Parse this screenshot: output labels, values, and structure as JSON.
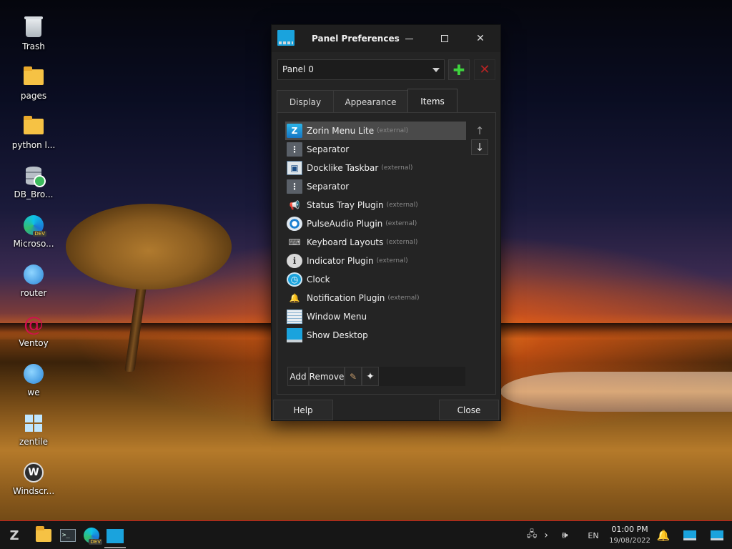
{
  "desktop": {
    "icons": [
      {
        "label": "Trash",
        "icon": "trash-icon"
      },
      {
        "label": "pages",
        "icon": "folder-icon"
      },
      {
        "label": "python l...",
        "icon": "folder-icon"
      },
      {
        "label": "DB_Bro...",
        "icon": "database-icon"
      },
      {
        "label": "Microso...",
        "icon": "edge-dev-icon"
      },
      {
        "label": "router",
        "icon": "globe-icon"
      },
      {
        "label": "Ventoy",
        "icon": "debian-icon"
      },
      {
        "label": "we",
        "icon": "globe-icon"
      },
      {
        "label": "zentile",
        "icon": "windows-logo-icon"
      },
      {
        "label": "Windscr...",
        "icon": "windscribe-icon"
      }
    ]
  },
  "dialog": {
    "title": "Panel Preferences",
    "panel_select": {
      "value": "Panel 0"
    },
    "add_panel_glyph": "✚",
    "remove_panel_glyph": "✕",
    "tabs": [
      {
        "label": "Display"
      },
      {
        "label": "Appearance"
      },
      {
        "label": "Items",
        "active": true
      }
    ],
    "items": [
      {
        "name": "Zorin Menu Lite",
        "ext": "(external)",
        "icon": "zorin-menu-icon",
        "glyph": "Z",
        "selected": true
      },
      {
        "name": "Separator",
        "ext": "",
        "icon": "separator-icon",
        "glyph": "⋮"
      },
      {
        "name": "Docklike Taskbar",
        "ext": "(external)",
        "icon": "taskbar-icon",
        "glyph": "▣"
      },
      {
        "name": "Separator",
        "ext": "",
        "icon": "separator-icon",
        "glyph": "⋮"
      },
      {
        "name": "Status Tray Plugin",
        "ext": "(external)",
        "icon": "megaphone-icon",
        "glyph": "📢"
      },
      {
        "name": "PulseAudio Plugin",
        "ext": "(external)",
        "icon": "speaker-icon",
        "glyph": ""
      },
      {
        "name": "Keyboard Layouts",
        "ext": "(external)",
        "icon": "keyboard-icon",
        "glyph": "⌨"
      },
      {
        "name": "Indicator Plugin",
        "ext": "(external)",
        "icon": "info-icon",
        "glyph": "i"
      },
      {
        "name": "Clock",
        "ext": "",
        "icon": "clock-icon",
        "glyph": "◷"
      },
      {
        "name": "Notification Plugin",
        "ext": "(external)",
        "icon": "bell-icon",
        "glyph": "🔔"
      },
      {
        "name": "Window Menu",
        "ext": "",
        "icon": "window-menu-icon",
        "glyph": ""
      },
      {
        "name": "Show Desktop",
        "ext": "",
        "icon": "show-desktop-icon",
        "glyph": ""
      }
    ],
    "move_up_glyph": "↑",
    "move_down_glyph": "↓",
    "toolbar": {
      "add_label": "Add",
      "remove_label": "Remove",
      "edit_glyph": "✎",
      "about_glyph": "✦"
    },
    "help_label": "Help",
    "close_label": "Close"
  },
  "taskbar": {
    "zorin_glyph": "Z",
    "terminal_glyph": ">_",
    "tray_chevron": "›",
    "tray_volume": "🕪",
    "language": "EN",
    "time": "01:00 PM",
    "date": "19/08/2022",
    "bell_glyph": "🔔",
    "network_glyph": "🖧"
  },
  "colors": {
    "accent": "#1aa3dd",
    "add_green": "#3ed33e",
    "remove_red": "#b52323",
    "taskbar_border": "#c81c1c"
  }
}
